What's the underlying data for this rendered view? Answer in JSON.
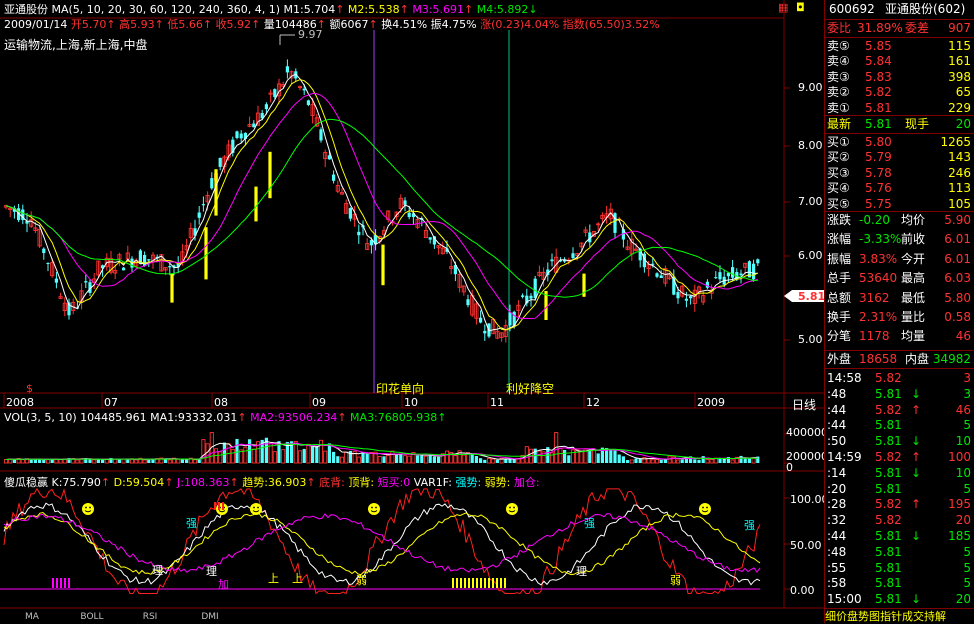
{
  "stock": {
    "name": "亚通股份",
    "ma_params": "MA(5, 10, 20, 30, 60, 120, 240, 360, 4, 1)",
    "m1": "M1:5.704",
    "m2": "M2:5.538",
    "m3": "M3:5.691",
    "m4": "M4:5.892",
    "date": "2009/01/14",
    "open": "开5.70",
    "high": "高5.93",
    "low": "低5.66",
    "close": "收5.92",
    "volume": "量104486",
    "amount": "额6067",
    "turnover": "换4.51%",
    "amplitude": "振4.75%",
    "change": "涨(0.23)4.04%",
    "index": "指数(65.50)3.52%",
    "sector": "运输物流,上海,新上海,中盘",
    "peak_label": "9.97",
    "current_price_tag": "5.81"
  },
  "price_axis": [
    "9.00",
    "8.00",
    "7.00",
    "6.00",
    "5.00"
  ],
  "date_axis": [
    "2008",
    "07",
    "08",
    "09",
    "10",
    "11",
    "12",
    "2009"
  ],
  "period_label": "日线",
  "annotations": {
    "stamp_tax": "印花单向",
    "rate_cut": "利好降空"
  },
  "volume_panel": {
    "legend_vol": "VOL(3, 5, 10) 104485.961",
    "legend_ma1": "MA1:93332.031",
    "legend_ma2": "MA2:93506.234",
    "legend_ma3": "MA3:76805.938",
    "axis": [
      "400000",
      "200000",
      "0"
    ]
  },
  "indicator_panel": {
    "name": "傻瓜稳赢",
    "k": "K:75.790",
    "d": "D:59.504",
    "j": "J:108.363",
    "trend": "趋势:36.903",
    "bottom": "底背:",
    "top": "顶背:",
    "short_buy": "短买:0",
    "var": "VAR1F:",
    "strong": "强势:",
    "weak": "弱势:",
    "add": "加仓:",
    "axis": [
      "100.00",
      "50.00",
      "0.00"
    ],
    "marks": [
      "强",
      "理",
      "理",
      "加",
      "上",
      "上",
      "弱",
      "理",
      "强",
      "弱",
      "强"
    ]
  },
  "tabs": [
    "MA",
    "BOLL",
    "RSI",
    "DMI"
  ],
  "quote": {
    "code": "600692",
    "name": "亚通股份(602)",
    "ratio_label": "委比",
    "ratio": "31.89%",
    "diff_label": "委差",
    "diff": "907",
    "asks": [
      {
        "label": "卖⑤",
        "price": "5.85",
        "vol": "115"
      },
      {
        "label": "卖④",
        "price": "5.84",
        "vol": "161"
      },
      {
        "label": "卖③",
        "price": "5.83",
        "vol": "398"
      },
      {
        "label": "卖②",
        "price": "5.82",
        "vol": "65"
      },
      {
        "label": "卖①",
        "price": "5.81",
        "vol": "229"
      }
    ],
    "last_label": "最新",
    "last": "5.81",
    "hand_label": "现手",
    "hand": "20",
    "bids": [
      {
        "label": "买①",
        "price": "5.80",
        "vol": "1265"
      },
      {
        "label": "买②",
        "price": "5.79",
        "vol": "143"
      },
      {
        "label": "买③",
        "price": "5.78",
        "vol": "246"
      },
      {
        "label": "买④",
        "price": "5.76",
        "vol": "113"
      },
      {
        "label": "买⑤",
        "price": "5.75",
        "vol": "105"
      }
    ],
    "stats": [
      {
        "l1": "涨跌",
        "v1": "-0.20",
        "l2": "均价",
        "v2": "5.90"
      },
      {
        "l1": "涨幅",
        "v1": "-3.33%",
        "l2": "前收",
        "v2": "6.01"
      },
      {
        "l1": "振幅",
        "v1": "3.83%",
        "l2": "今开",
        "v2": "6.01"
      },
      {
        "l1": "总手",
        "v1": "53640",
        "l2": "最高",
        "v2": "6.03"
      },
      {
        "l1": "总额",
        "v1": "3162",
        "l2": "最低",
        "v2": "5.80"
      },
      {
        "l1": "换手",
        "v1": "2.31%",
        "l2": "量比",
        "v2": "0.58"
      },
      {
        "l1": "分笔",
        "v1": "1178",
        "l2": "均量",
        "v2": "46"
      }
    ],
    "outer_label": "外盘",
    "outer": "18658",
    "inner_label": "内盘",
    "inner": "34982",
    "ticks": [
      {
        "t": "14:58",
        "p": "5.82",
        "arrow": "",
        "v": "3",
        "c": "rd"
      },
      {
        "t": ":48",
        "p": "5.81",
        "arrow": "↓",
        "v": "3",
        "c": "gn"
      },
      {
        "t": ":44",
        "p": "5.82",
        "arrow": "↑",
        "v": "46",
        "c": "rd"
      },
      {
        "t": ":44",
        "p": "5.81",
        "arrow": "",
        "v": "5",
        "c": "gn"
      },
      {
        "t": ":50",
        "p": "5.81",
        "arrow": "↓",
        "v": "10",
        "c": "gn"
      },
      {
        "t": "14:59",
        "p": "5.82",
        "arrow": "↑",
        "v": "100",
        "c": "rd"
      },
      {
        "t": ":14",
        "p": "5.81",
        "arrow": "↓",
        "v": "10",
        "c": "gn"
      },
      {
        "t": ":20",
        "p": "5.81",
        "arrow": "",
        "v": "5",
        "c": "gn"
      },
      {
        "t": ":28",
        "p": "5.82",
        "arrow": "↑",
        "v": "195",
        "c": "rd"
      },
      {
        "t": ":32",
        "p": "5.82",
        "arrow": "",
        "v": "20",
        "c": "rd"
      },
      {
        "t": ":44",
        "p": "5.81",
        "arrow": "↓",
        "v": "185",
        "c": "gn"
      },
      {
        "t": ":48",
        "p": "5.81",
        "arrow": "",
        "v": "5",
        "c": "gn"
      },
      {
        "t": ":55",
        "p": "5.81",
        "arrow": "",
        "v": "5",
        "c": "gn"
      },
      {
        "t": ":58",
        "p": "5.81",
        "arrow": "",
        "v": "5",
        "c": "gn"
      },
      {
        "t": "15:00",
        "p": "5.81",
        "arrow": "↓",
        "v": "20",
        "c": "gn"
      }
    ],
    "footer": "细价盘势图指针成交持解"
  },
  "colors": {
    "up": "#ff3232",
    "down": "#54ffff",
    "grid": "#800000",
    "ma1": "#ffffff",
    "ma2": "#ffff00",
    "ma3": "#ff00ff",
    "ma4": "#00ff00"
  }
}
